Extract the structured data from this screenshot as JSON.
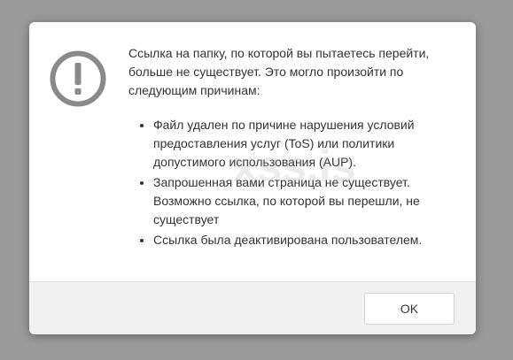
{
  "dialog": {
    "icon": "exclamation-circle-icon",
    "intro": "Ссылка на папку, по которой вы пытаетесь перейти, больше не существует. Это могло произойти по следующим причинам:",
    "reasons": [
      "Файл удален по причине нарушения условий предоставления услуг (ToS) или политики допустимого использования (AUP).",
      "Запрошенная вами страница не существует. Возможно ссылка, по которой вы перешли, не существует",
      "Ссылка была деактивирована пользователем."
    ],
    "ok_label": "OK"
  },
  "watermark": {
    "text": "xss.is"
  },
  "colors": {
    "overlay": "#9a9a9a",
    "icon": "#8a8a8a",
    "text": "#333333",
    "footer": "#f1f1f1"
  }
}
